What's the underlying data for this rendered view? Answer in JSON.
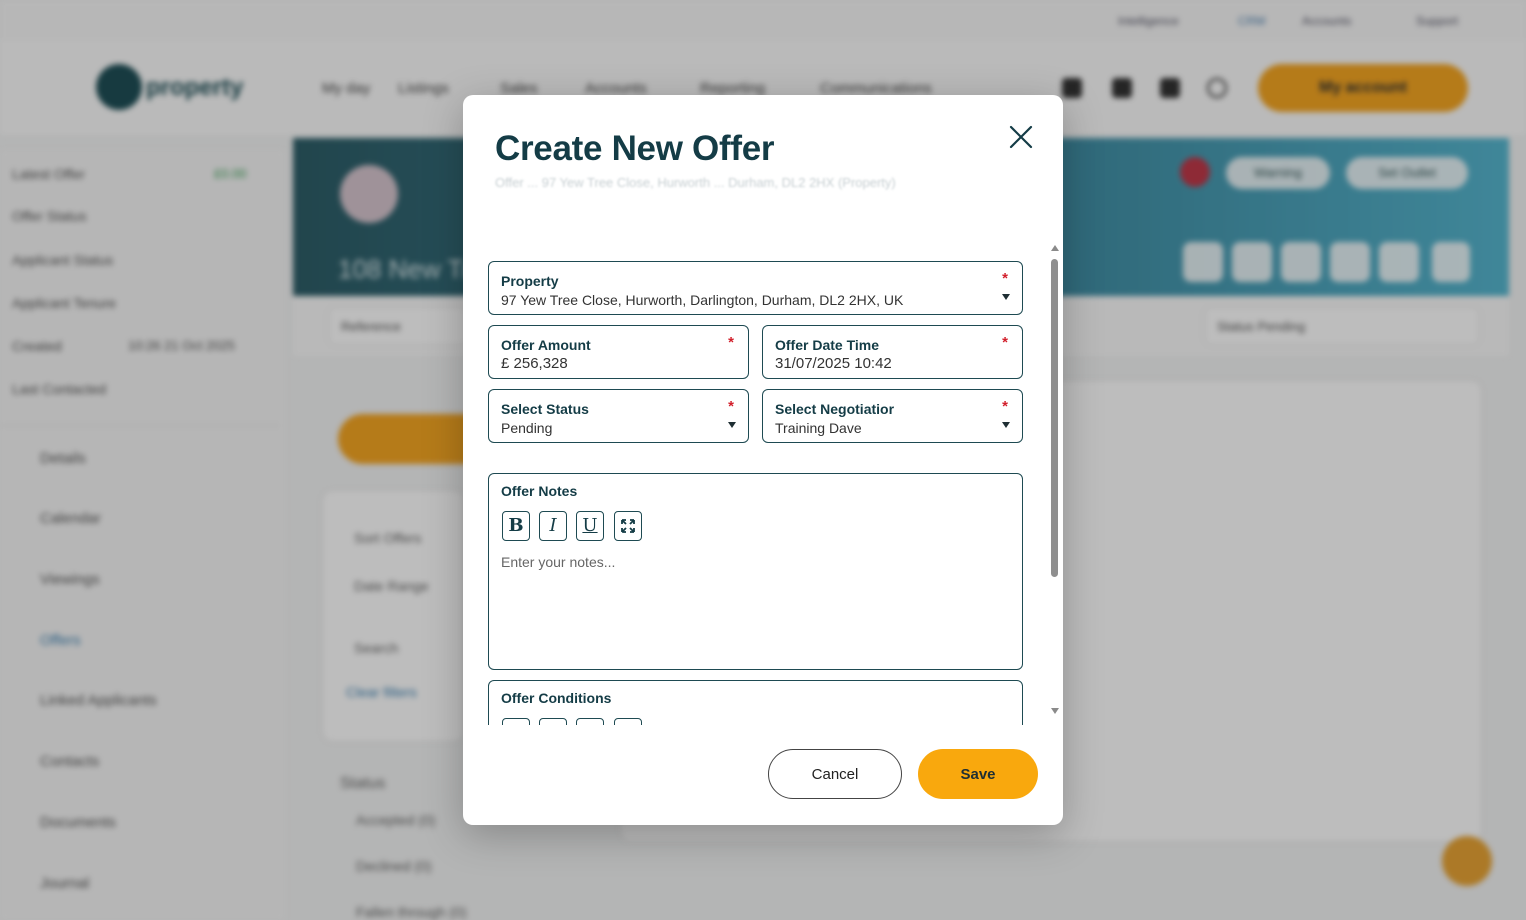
{
  "modal": {
    "title": "Create New Offer",
    "subtitle_ghost": "Offer ... 97 Yew Tree Close, Hurworth ... Durham, DL2 2HX (Property)",
    "fields": {
      "property": {
        "label": "Property",
        "required_mark": "*",
        "value": "97 Yew Tree Close, Hurworth, Darlington, Durham, DL2 2HX, UK"
      },
      "offer_amount": {
        "label": "Offer Amount",
        "required_mark": "*",
        "value": "£ 256,328"
      },
      "offer_date_time": {
        "label": "Offer Date Time",
        "required_mark": "*",
        "value": "31/07/2025 10:42"
      },
      "status": {
        "label": "Select Status",
        "required_mark": "*",
        "value": "Pending"
      },
      "negotiator": {
        "label": "Select Negotiatior",
        "required_mark": "*",
        "value": "Training Dave"
      },
      "offer_notes": {
        "label": "Offer Notes",
        "placeholder": "Enter your notes...",
        "toolbar": {
          "bold": "B",
          "italic": "I",
          "underline": "U"
        }
      },
      "offer_conditions": {
        "label": "Offer Conditions"
      }
    },
    "buttons": {
      "cancel": "Cancel",
      "save": "Save"
    },
    "colors": {
      "primary_dark": "#143c46",
      "accent": "#f9a80d",
      "required": "#d21f2b"
    }
  },
  "background": {
    "top_links": [
      "Intelligence",
      "CRM",
      "Accounts",
      "Support"
    ],
    "logo_text": "property",
    "nav": [
      "My day",
      "Listings",
      "Sales",
      "Accounts",
      "Reporting",
      "Communications"
    ],
    "account_button": "My account",
    "banner_title": "108 New Tree...",
    "banner_pills": [
      "Warning",
      "Set Outlet"
    ],
    "subfields": [
      "Reference",
      "Status   Pending"
    ],
    "sidebar_info": [
      {
        "label": "Latest Offer",
        "value": "£0.00"
      },
      {
        "label": "Offer Status",
        "value": ""
      },
      {
        "label": "Applicant Status",
        "value": ""
      },
      {
        "label": "Applicant Tenure",
        "value": ""
      },
      {
        "label": "Created",
        "value": "10:26 21 Oct 2025"
      },
      {
        "label": "Last Contacted",
        "value": ""
      }
    ],
    "sidebar_menu": [
      "Details",
      "Calendar",
      "Viewings",
      "Offers",
      "Linked Applicants",
      "Contacts",
      "Documents",
      "Journal"
    ],
    "filters": [
      "Sort Offers",
      "Date Range",
      "Search",
      "Clear filters"
    ],
    "status_heading": "Status",
    "status_items": [
      "Accepted (0)",
      "Declined (0)",
      "Fallen through (0)"
    ]
  }
}
